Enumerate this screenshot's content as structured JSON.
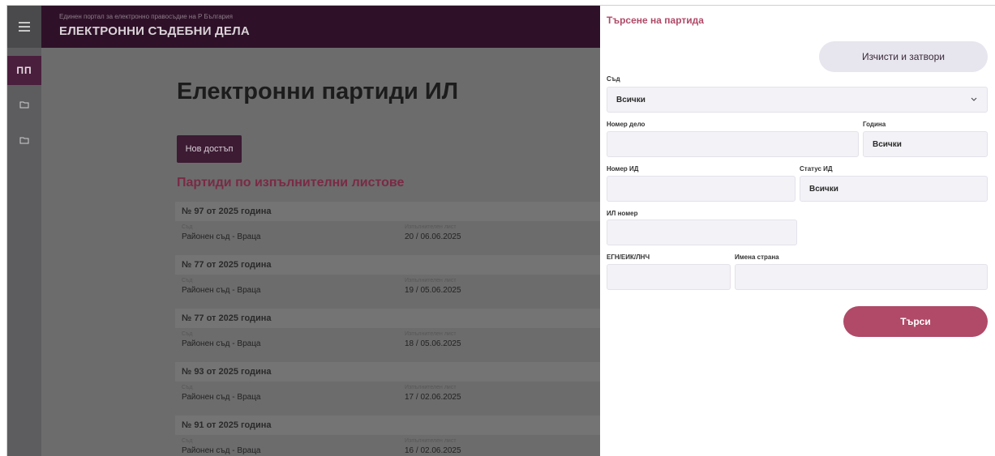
{
  "header": {
    "subtitle": "Единен портал за електронно правосъдие на Р България",
    "title": "ЕЛЕКТРОННИ СЪДЕБНИ ДЕЛА"
  },
  "rail": {
    "active_label": "ПП",
    "icons": [
      "hamburger-icon",
      "folder-icon",
      "folder-icon"
    ]
  },
  "main": {
    "page_title": "Електронни партиди ИЛ",
    "new_access_label": "Нов достъп",
    "section_title": "Партиди по изпълнителни листове",
    "court_label": "Съд",
    "writ_label": "Изпълнителен лист",
    "cases": [
      {
        "title": "№ 97 от 2025 година",
        "court": "Районен съд - Враца",
        "writ": "20 / 06.06.2025"
      },
      {
        "title": "№ 77 от 2025 година",
        "court": "Районен съд - Враца",
        "writ": "19 / 05.06.2025"
      },
      {
        "title": "№ 77 от 2025 година",
        "court": "Районен съд - Враца",
        "writ": "18 / 05.06.2025"
      },
      {
        "title": "№ 93 от 2025 година",
        "court": "Районен съд - Враца",
        "writ": "17 / 02.06.2025"
      },
      {
        "title": "№ 91 от 2025 година",
        "court": "Районен съд - Враца",
        "writ": "16 / 02.06.2025"
      }
    ]
  },
  "panel": {
    "title": "Търсене на партида",
    "clear_label": "Изчисти и затвори",
    "court_label": "Съд",
    "court_value": "Всички",
    "case_number_label": "Номер дело",
    "case_number_value": "",
    "year_label": "Година",
    "year_value": "Всички",
    "id_number_label": "Номер ИД",
    "id_number_value": "",
    "id_status_label": "Статус ИД",
    "id_status_value": "Всички",
    "il_number_label": "ИЛ номер",
    "il_number_value": "",
    "egn_label": "ЕГН/ЕИК/ЛНЧ",
    "egn_value": "",
    "party_names_label": "Имена страна",
    "party_names_value": "",
    "search_label": "Търси"
  },
  "colors": {
    "header_bg": "#2e1128",
    "accent": "#b04a68",
    "overlay_content": "#6c6c6d"
  }
}
